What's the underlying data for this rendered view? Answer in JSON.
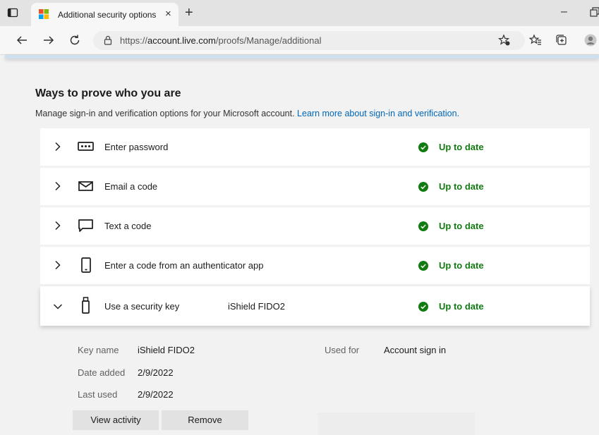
{
  "browser": {
    "tab_title": "Additional security options",
    "tab_close": "×",
    "new_tab": "+",
    "minimize": "–",
    "url_prefix": "https://",
    "url_host": "account.live.com",
    "url_path": "/proofs/Manage/additional"
  },
  "page": {
    "heading": "Ways to prove who you are",
    "subtext": "Manage sign-in and verification options for your Microsoft account.",
    "learn_more_link": "Learn more about sign-in and verification."
  },
  "methods": [
    {
      "label": "Enter password",
      "status": "Up to date",
      "icon": "password-icon"
    },
    {
      "label": "Email a code",
      "status": "Up to date",
      "icon": "envelope-icon"
    },
    {
      "label": "Text a code",
      "status": "Up to date",
      "icon": "chat-bubble-icon"
    },
    {
      "label": "Enter a code from an authenticator app",
      "status": "Up to date",
      "icon": "phone-icon"
    },
    {
      "label": "Use a security key",
      "extra": "iShield FIDO2",
      "status": "Up to date",
      "icon": "security-key-icon",
      "expanded": true
    }
  ],
  "security_key": {
    "key_name_label": "Key name",
    "key_name": "iShield FIDO2",
    "used_for_label": "Used for",
    "used_for": "Account sign in",
    "date_added_label": "Date added",
    "date_added": "2/9/2022",
    "last_used_label": "Last used",
    "last_used": "2/9/2022",
    "view_activity": "View activity",
    "remove": "Remove"
  },
  "colors": {
    "status_green": "#107c10",
    "link_blue": "#0067b8"
  }
}
